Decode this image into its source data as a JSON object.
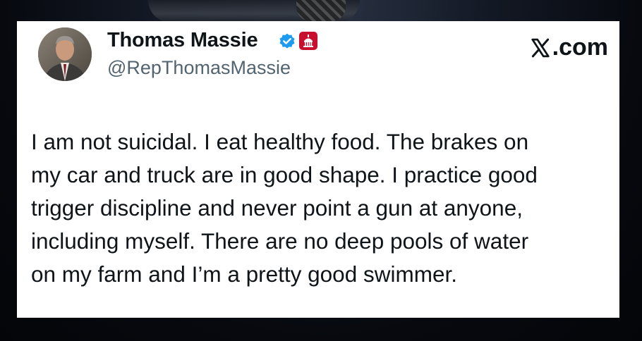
{
  "post": {
    "author": {
      "display_name": "Thomas Massie",
      "handle": "@RepThomasMassie",
      "avatar_icon": "profile-photo",
      "verified_icon": "verified-badge-icon",
      "affiliation_icon": "government-badge-icon"
    },
    "brand": {
      "label": ".com",
      "icon": "x-logo-icon"
    },
    "text_lines": [
      "I am not suicidal. I eat healthy food. The brakes on",
      "my car and truck are in good shape. I practice good",
      "trigger discipline and never point a gun at anyone,",
      "including myself. There are no deep pools of water",
      "on my farm and I’m a pretty good swimmer."
    ]
  },
  "colors": {
    "text_primary": "#0f1419",
    "text_secondary": "#536471",
    "verified_blue": "#1d9bf0",
    "gov_badge_red": "#c8102e"
  }
}
